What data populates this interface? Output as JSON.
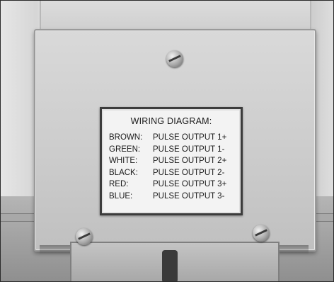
{
  "label": {
    "title": "WIRING DIAGRAM:",
    "rows": [
      {
        "color": "BROWN:",
        "signal": "PULSE OUTPUT 1+"
      },
      {
        "color": "GREEN:",
        "signal": "PULSE OUTPUT 1-"
      },
      {
        "color": "WHITE:",
        "signal": "PULSE OUTPUT 2+"
      },
      {
        "color": "BLACK:",
        "signal": "PULSE OUTPUT 2-"
      },
      {
        "color": "RED:",
        "signal": "PULSE OUTPUT 3+"
      },
      {
        "color": "BLUE:",
        "signal": "PULSE OUTPUT 3-"
      }
    ]
  },
  "colors": {
    "panel": "#cbcbcb",
    "label_background": "#f3f3f3",
    "label_border": "#3c3c3c",
    "text": "#1a1a1a"
  }
}
